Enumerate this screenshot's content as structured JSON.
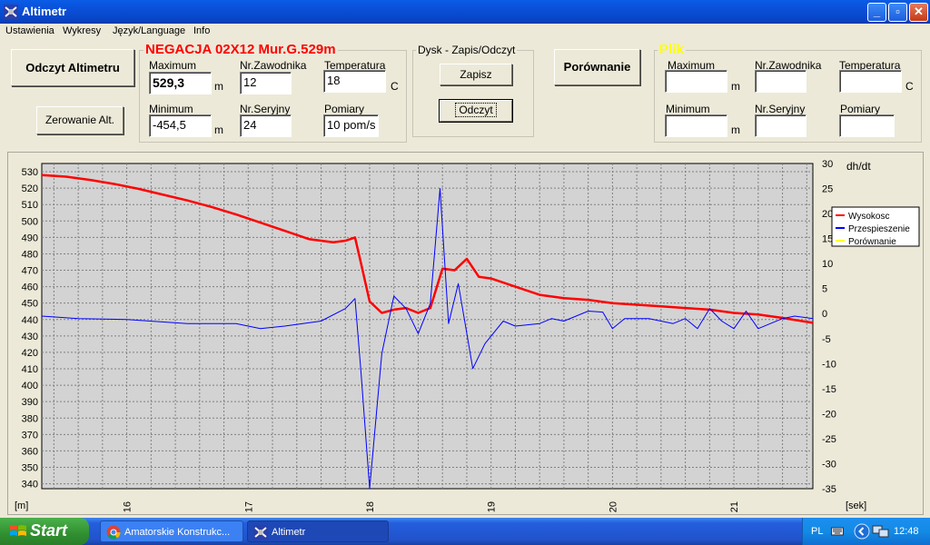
{
  "window": {
    "title": "Altimetr",
    "controls": {
      "minimize": "_",
      "maximize": "▫",
      "close": "✕"
    }
  },
  "menu": [
    "Ustawienia",
    "Wykresy",
    "Język/Language",
    "Info"
  ],
  "buttons": {
    "read_altimeter": "Odczyt Altimetru",
    "reset_alt": "Zerowanie Alt.",
    "save": "Zapisz",
    "load": "Odczyt",
    "compare": "Porównanie"
  },
  "current": {
    "title": "NEGACJA 02X12 Mur.G.529m",
    "maximum_label": "Maximum",
    "maximum_value": "529,3",
    "maximum_unit": "m",
    "minimum_label": "Minimum",
    "minimum_value": "-454,5",
    "minimum_unit": "m",
    "competitor_label": "Nr.Zawodnika",
    "competitor_value": "12",
    "serial_label": "Nr.Seryjny",
    "serial_value": "24",
    "temperature_label": "Temperatura",
    "temperature_value": "18",
    "temperature_unit": "C",
    "measurements_label": "Pomiary",
    "measurements_value": "10 pom/s"
  },
  "disk": {
    "title": "Dysk - Zapis/Odczyt"
  },
  "file": {
    "title": "Plik",
    "maximum_label": "Maximum",
    "maximum_value": "",
    "maximum_unit": "m",
    "minimum_label": "Minimum",
    "minimum_value": "",
    "minimum_unit": "m",
    "competitor_label": "Nr.Zawodnika",
    "competitor_value": "",
    "serial_label": "Nr.Seryjny",
    "serial_value": "",
    "temperature_label": "Temperatura",
    "temperature_value": "",
    "temperature_unit": "C",
    "measurements_label": "Pomiary",
    "measurements_value": ""
  },
  "colors": {
    "title_red": "#ff0000",
    "plik_yellow": "#ffff00",
    "altitude": "#ff0000",
    "acceleration": "#0000ff",
    "comparison": "#ffff00"
  },
  "chart_data": {
    "type": "line",
    "xlabel": "[sek]",
    "ylabel": "[m]",
    "y2label": "dh/dt",
    "xlim": [
      15.3,
      21.65
    ],
    "ylim": [
      337,
      535
    ],
    "y2lim": [
      -35,
      30
    ],
    "x_ticks": [
      16,
      17,
      18,
      19,
      20,
      21
    ],
    "y_ticks": [
      340,
      350,
      360,
      370,
      380,
      390,
      400,
      410,
      420,
      430,
      440,
      450,
      460,
      470,
      480,
      490,
      500,
      510,
      520,
      530
    ],
    "y2_ticks": [
      -35,
      -30,
      -25,
      -20,
      -15,
      -10,
      -5,
      0,
      5,
      10,
      15,
      20,
      25,
      30
    ],
    "grid": true,
    "legend_position": "right",
    "series": [
      {
        "name": "Wysokosc",
        "axis": "left",
        "x": [
          15.3,
          15.5,
          15.7,
          15.9,
          16.1,
          16.3,
          16.5,
          16.7,
          16.9,
          17.1,
          17.3,
          17.5,
          17.7,
          17.8,
          17.88,
          17.93,
          18.0,
          18.1,
          18.2,
          18.3,
          18.4,
          18.5,
          18.6,
          18.7,
          18.8,
          18.9,
          19.0,
          19.2,
          19.4,
          19.6,
          19.8,
          20.0,
          20.2,
          20.4,
          20.6,
          20.8,
          21.0,
          21.2,
          21.4,
          21.65
        ],
        "y": [
          528,
          527,
          525,
          522.5,
          519.5,
          516,
          512.5,
          508.5,
          504,
          499,
          494,
          489,
          487,
          488,
          490,
          474,
          451,
          444,
          446,
          447,
          444,
          447,
          471,
          470,
          477,
          466,
          465,
          460,
          455,
          453,
          452,
          450,
          449,
          448,
          447,
          446,
          444,
          443,
          441,
          438
        ]
      },
      {
        "name": "Przespieszenie",
        "axis": "right",
        "x": [
          15.3,
          15.6,
          16.0,
          16.5,
          16.9,
          17.1,
          17.3,
          17.6,
          17.8,
          17.88,
          17.93,
          18.0,
          18.1,
          18.2,
          18.3,
          18.4,
          18.5,
          18.58,
          18.65,
          18.73,
          18.85,
          18.95,
          19.1,
          19.2,
          19.4,
          19.5,
          19.6,
          19.8,
          19.92,
          20.0,
          20.1,
          20.3,
          20.5,
          20.6,
          20.7,
          20.8,
          20.9,
          21.0,
          21.1,
          21.2,
          21.4,
          21.5,
          21.65
        ],
        "y": [
          -0.5,
          -1,
          -1.2,
          -2,
          -2,
          -3,
          -2.5,
          -1.5,
          1,
          3,
          -12,
          -35,
          -8,
          3.5,
          1,
          -4,
          2,
          25,
          -2,
          6,
          -11,
          -6,
          -1.5,
          -2.5,
          -2,
          -1,
          -1.5,
          0.5,
          0.3,
          -3,
          -1,
          -1,
          -2,
          -1,
          -3,
          1,
          -1.5,
          -3,
          0.5,
          -3,
          -1,
          -0.5,
          -1
        ]
      },
      {
        "name": "Porównanie",
        "axis": "left",
        "x": [],
        "y": []
      }
    ]
  },
  "taskbar": {
    "start": "Start",
    "tasks": [
      "Amatorskie Konstrukc...",
      "Altimetr"
    ],
    "lang": "PL",
    "time": "12:48"
  }
}
